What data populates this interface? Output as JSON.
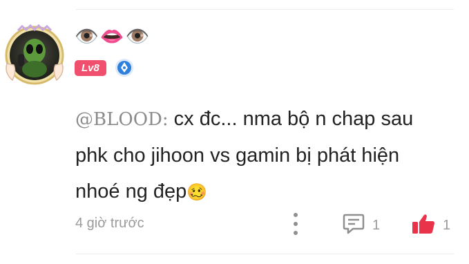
{
  "user": {
    "display_name": "👁️👄👁️",
    "level_badge": "Lv8"
  },
  "comment": {
    "mention": "@BLOOD:",
    "text": " cx đc... nma bộ n chap sau phk cho jihoon vs gamin bị phát hiện nhoé ng đẹp",
    "emoji": "🥴"
  },
  "footer": {
    "time": "4 giờ trước",
    "reply_count": "1",
    "like_count": "1"
  },
  "colors": {
    "level_badge": "#f0506e",
    "like_active": "#e8334a",
    "pen_badge": "#2f7fdc"
  }
}
